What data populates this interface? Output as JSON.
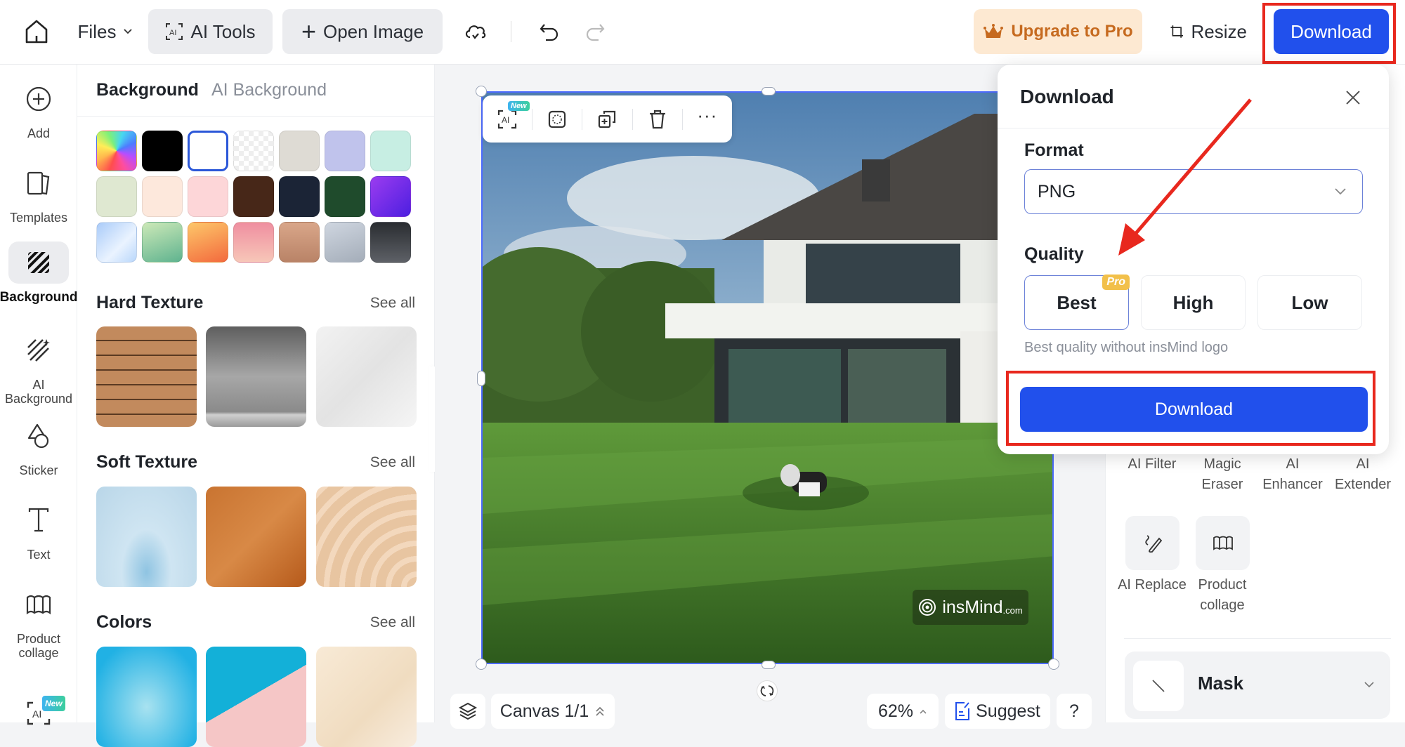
{
  "topbar": {
    "files_label": "Files",
    "ai_tools_label": "AI Tools",
    "open_image_label": "Open Image",
    "upgrade_label": "Upgrade to Pro",
    "resize_label": "Resize",
    "download_label": "Download"
  },
  "rail": {
    "items": [
      {
        "label": "Add",
        "icon": "plus-circle-icon"
      },
      {
        "label": "Templates",
        "icon": "templates-icon"
      },
      {
        "label": "Background",
        "icon": "background-icon",
        "active": true
      },
      {
        "label": "AI Background",
        "icon": "ai-background-icon"
      },
      {
        "label": "Sticker",
        "icon": "sticker-icon"
      },
      {
        "label": "Text",
        "icon": "text-icon"
      },
      {
        "label": "Product collage",
        "icon": "collage-icon"
      }
    ],
    "new_badge": "New"
  },
  "panel": {
    "tabs": [
      {
        "label": "Background",
        "active": true
      },
      {
        "label": "AI Background",
        "active": false
      }
    ],
    "swatches": [
      "rainbow",
      "#000000",
      "#ffffff",
      "transparent",
      "#dedbd4",
      "#c0c3ec",
      "#c7eee3",
      "#dfe8d1",
      "#fde8dc",
      "#fdd6d8",
      "#472718",
      "#1b2436",
      "#1f4b2c",
      "purple-gradient",
      "blue-gradient",
      "green-gradient",
      "orange-gradient",
      "pink-gradient",
      "tan-gradient",
      "silver-gradient",
      "dark-gradient"
    ],
    "selected_swatch": 2,
    "sections": [
      {
        "title": "Hard Texture",
        "see_all": "See all"
      },
      {
        "title": "Soft Texture",
        "see_all": "See all"
      },
      {
        "title": "Colors",
        "see_all": "See all"
      }
    ]
  },
  "canvas": {
    "toolbar_new_badge": "New",
    "watermark": "insMind",
    "watermark_suffix": ".com",
    "canvas_label": "Canvas 1/1",
    "zoom": "62%",
    "suggest_label": "Suggest",
    "help_label": "?"
  },
  "right_panel": {
    "tools_row1": [
      "AI Filter",
      "Magic Eraser",
      "AI Enhancer",
      "AI Extender"
    ],
    "tools_row2": [
      "AI Replace",
      "Product collage"
    ],
    "mask_label": "Mask"
  },
  "download_popover": {
    "title": "Download",
    "format_label": "Format",
    "format_value": "PNG",
    "quality_label": "Quality",
    "quality_options": [
      {
        "label": "Best",
        "badge": "Pro",
        "selected": true
      },
      {
        "label": "High",
        "selected": false
      },
      {
        "label": "Low",
        "selected": false
      }
    ],
    "quality_hint": "Best quality without insMind logo",
    "download_button": "Download"
  },
  "colors": {
    "primary": "#2150ec",
    "annotation_red": "#e8281e",
    "upgrade_bg": "#fde9d2",
    "upgrade_text": "#c66a1f",
    "pro_badge": "#f2c04a"
  }
}
